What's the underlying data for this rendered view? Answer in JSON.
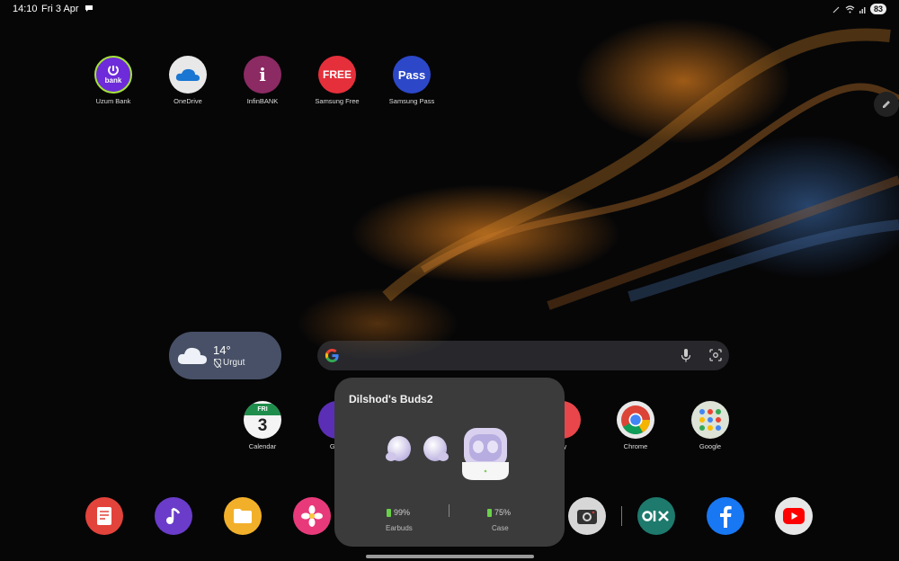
{
  "status_bar": {
    "time": "14:10",
    "date": "Fri 3 Apr",
    "battery": "83"
  },
  "top_apps": [
    {
      "label": "Uzum Bank",
      "icon": "uzum-bank-icon",
      "glyph": "bank"
    },
    {
      "label": "OneDrive",
      "icon": "onedrive-icon",
      "glyph": ""
    },
    {
      "label": "InfinBANK",
      "icon": "infinbank-icon",
      "glyph": "i"
    },
    {
      "label": "Samsung Free",
      "icon": "samsung-free-icon",
      "glyph": "FREE"
    },
    {
      "label": "Samsung Pass",
      "icon": "samsung-pass-icon",
      "glyph": "Pass"
    }
  ],
  "weather": {
    "temperature": "14°",
    "location": "Urgut"
  },
  "middle_apps": [
    {
      "label": "Calendar",
      "icon": "calendar-icon",
      "day": "FRI",
      "date": "3"
    },
    {
      "label": "Gam",
      "icon": "game-launcher-icon"
    },
    {
      "label": "ery",
      "icon": "gallery-icon"
    },
    {
      "label": "Chrome",
      "icon": "chrome-icon"
    },
    {
      "label": "Google",
      "icon": "google-folder-icon"
    }
  ],
  "dock_apps": [
    {
      "icon": "notes-icon",
      "color": "#e2433b"
    },
    {
      "icon": "music-icon",
      "color": "#6a3cc9"
    },
    {
      "icon": "my-files-icon",
      "color": "#f2b02a"
    },
    {
      "icon": "gallery-icon",
      "color": "#e83a7a"
    },
    {
      "icon": "camera-icon",
      "color": "#d7d7d7"
    },
    {
      "icon": "olx-icon",
      "color": "#1d7a6c"
    },
    {
      "icon": "facebook-icon",
      "color": "#1877f2"
    },
    {
      "icon": "youtube-icon",
      "color": "#e7e7e7"
    }
  ],
  "buds_popup": {
    "title": "Dilshod's Buds2",
    "earbuds_battery": "99%",
    "earbuds_label": "Earbuds",
    "case_battery": "75%",
    "case_label": "Case",
    "battery_color": "#6ad04a"
  }
}
